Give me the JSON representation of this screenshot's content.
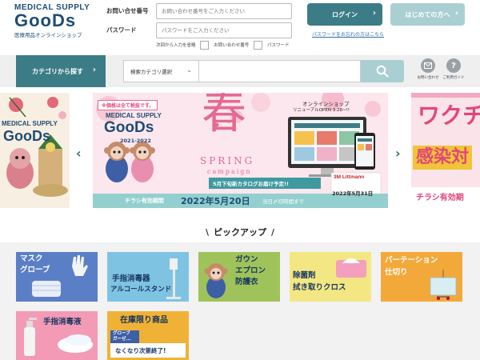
{
  "logo": {
    "top": "MEDICAL SUPPLY",
    "main": "GooDs",
    "sub": "医療用品オンラインショップ"
  },
  "login": {
    "inquiry_label": "お問い合せ番号",
    "inquiry_placeholder": "お問い合わせ番号をご入力ください",
    "password_label": "パスワード",
    "password_placeholder": "パスワードをご入力ください",
    "remember_text": "次回から入力を省略",
    "remember_inquiry": "お問い合わせ番号",
    "remember_password": "パスワード",
    "login_button": "ログイン",
    "first_button": "はじめての方へ",
    "forgot_link": "パスワードをお忘れの方はこちら"
  },
  "nav": {
    "category_button": "カテゴリから探す",
    "search_select": "検索カテゴリ選択",
    "contact_label": "お問い合わせ",
    "guide_label": "ご利用ガイド"
  },
  "banner": {
    "tax_note": "※価格は全て税抜です。",
    "brand_top": "MEDICAL SUPPLY",
    "brand_main": "GooDs",
    "year": "2021-2022",
    "spring_kanji": "春",
    "spring_word": "SPRING",
    "campaign_word": "campaign",
    "online_shop": "オンラインショップ",
    "renewal": "リニューアルOPEN 3.28~!!",
    "catalog_note": "5月下旬新カタログお届け予定!!",
    "littmann": "3M Littmann",
    "deadline": "2022年5月31日",
    "flyer_period": "チラシ有効期間",
    "flyer_date": "2022年5月20日",
    "flyer_end": "当日〆切時間まで",
    "left_brand_top": "MEDICAL SUPPLY",
    "left_brand_main": "GooDs",
    "right_top": "ワクチ",
    "right_mid": "感染対",
    "right_bottom": "チラシ有効期"
  },
  "pickup": {
    "title": "ピックアップ",
    "tiles": [
      {
        "line1": "マスク",
        "line2": "グローブ"
      },
      {
        "line1": "手指消毒器",
        "line2": "アルコールスタンド"
      },
      {
        "line1": "ガウン",
        "line2": "エプロン",
        "line3": "防護衣"
      },
      {
        "line1": "除菌剤",
        "line2": "拭き取りクロス"
      },
      {
        "line1": "パーテーション",
        "line2": "仕切り"
      },
      {
        "line1": "手指消毒液"
      },
      {
        "line1": "在庫限り商品",
        "line2": "なくなり次第終了!",
        "tag1": "グローブ",
        "tag2": "ガーゼ..."
      }
    ]
  },
  "colors": {
    "brand": "#1d4d73",
    "accent": "#3c7c86",
    "accent_light": "#a9cfd3"
  }
}
